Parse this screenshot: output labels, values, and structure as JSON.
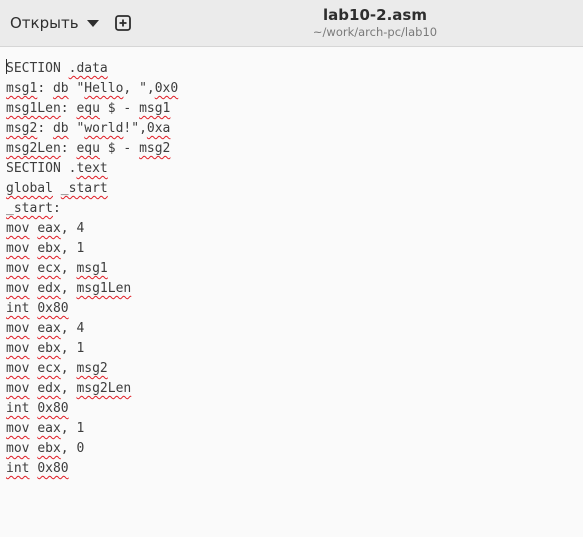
{
  "window": {
    "title": "lab10-2.asm",
    "subtitle": "~/work/arch-pc/lab10"
  },
  "toolbar": {
    "open_label": "Открыть",
    "open_icon": "chevron-down-icon",
    "new_icon": "plus-square-icon"
  },
  "editor": {
    "lines": [
      [
        "SECTION ",
        {
          "w": ".data"
        }
      ],
      [
        {
          "w": "msg1"
        },
        ": ",
        {
          "w": "db"
        },
        " \"",
        {
          "w": "Hello"
        },
        ", \",",
        {
          "w": "0x0"
        }
      ],
      [
        {
          "w": "msg1Len"
        },
        ": ",
        {
          "w": "equ"
        },
        " $ - ",
        {
          "w": "msg1"
        }
      ],
      [
        {
          "w": "msg2"
        },
        ": ",
        {
          "w": "db"
        },
        " \"",
        {
          "w": "world"
        },
        "!\",",
        {
          "w": "0xa"
        }
      ],
      [
        {
          "w": "msg2Len"
        },
        ": ",
        {
          "w": "equ"
        },
        " $ - ",
        {
          "w": "msg2"
        }
      ],
      [
        "SECTION .",
        {
          "w": "text"
        }
      ],
      [
        {
          "w": "global"
        },
        " ",
        {
          "w": "_start"
        }
      ],
      [
        {
          "w": "_start"
        },
        ":"
      ],
      [
        {
          "w": "mov"
        },
        " ",
        {
          "w": "eax"
        },
        ", 4"
      ],
      [
        {
          "w": "mov"
        },
        " ",
        {
          "w": "ebx"
        },
        ", 1"
      ],
      [
        {
          "w": "mov"
        },
        " ",
        {
          "w": "ecx"
        },
        ", ",
        {
          "w": "msg1"
        }
      ],
      [
        {
          "w": "mov"
        },
        " ",
        {
          "w": "edx"
        },
        ", ",
        {
          "w": "msg1Len"
        }
      ],
      [
        {
          "w": "int"
        },
        " ",
        {
          "w": "0x80"
        }
      ],
      [
        {
          "w": "mov"
        },
        " ",
        {
          "w": "eax"
        },
        ", 4"
      ],
      [
        {
          "w": "mov"
        },
        " ",
        {
          "w": "ebx"
        },
        ", 1"
      ],
      [
        {
          "w": "mov"
        },
        " ",
        {
          "w": "ecx"
        },
        ", ",
        {
          "w": "msg2"
        }
      ],
      [
        {
          "w": "mov"
        },
        " ",
        {
          "w": "edx"
        },
        ", ",
        {
          "w": "msg2Len"
        }
      ],
      [
        {
          "w": "int"
        },
        " ",
        {
          "w": "0x80"
        }
      ],
      [
        {
          "w": "mov"
        },
        " ",
        {
          "w": "eax"
        },
        ", 1"
      ],
      [
        {
          "w": "mov"
        },
        " ",
        {
          "w": "ebx"
        },
        ", 0"
      ],
      [
        {
          "w": "int"
        },
        " ",
        {
          "w": "0x80"
        }
      ]
    ]
  }
}
